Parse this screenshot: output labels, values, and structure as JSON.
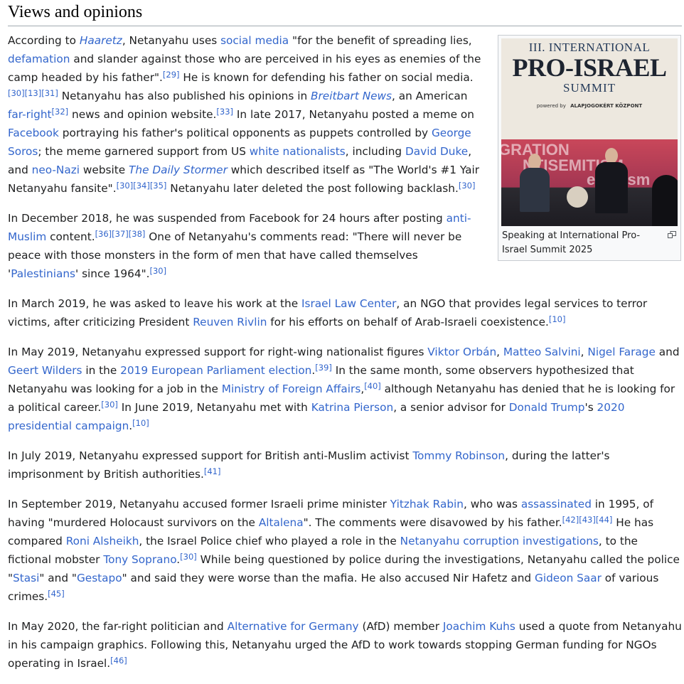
{
  "section": {
    "title": "Views and opinions"
  },
  "figure": {
    "banner_line1": "III. INTERNATIONAL",
    "banner_line2": "PRO-ISRAEL",
    "banner_line3": "SUMMIT",
    "banner_powered": "powered by",
    "banner_org": "ALAPJOGOKÉRT KÖZPONT",
    "stage_text_1": "GRATION",
    "stage_text_2": "NTISEMITISM",
    "stage_text_3": "errorism",
    "caption": "Speaking at International Pro-Israel Summit 2025",
    "enlarge_icon": "enlarge-icon"
  },
  "paragraphs": [
    {
      "name": "para-haaretz",
      "narrow": true,
      "runs": [
        {
          "t": "According to "
        },
        {
          "t": "Haaretz",
          "link": true,
          "italic": true
        },
        {
          "t": ", Netanyahu uses "
        },
        {
          "t": "social media",
          "link": true
        },
        {
          "t": " \"for the benefit of spreading lies, "
        },
        {
          "t": "defamation",
          "link": true
        },
        {
          "t": " and slander against those who are perceived in his eyes as enemies of the camp headed by his father\"."
        },
        {
          "t": "[29]",
          "sup": true
        },
        {
          "t": " He is known for defending his father on social media."
        },
        {
          "t": "[30]",
          "sup": true
        },
        {
          "t": "[13]",
          "sup": true
        },
        {
          "t": "[31]",
          "sup": true
        },
        {
          "t": " Netanyahu has also published his opinions in "
        },
        {
          "t": "Breitbart News",
          "link": true,
          "italic": true
        },
        {
          "t": ", an American "
        },
        {
          "t": "far-right",
          "link": true
        },
        {
          "t": "[32]",
          "sup": true
        },
        {
          "t": " news and opinion website."
        },
        {
          "t": "[33]",
          "sup": true
        },
        {
          "t": " In late 2017, Netanyahu posted a meme on "
        },
        {
          "t": "Facebook",
          "link": true
        },
        {
          "t": " portraying his father's political opponents as puppets controlled by "
        },
        {
          "t": "George Soros",
          "link": true
        },
        {
          "t": "; the meme garnered support from US "
        },
        {
          "t": "white nationalists",
          "link": true
        },
        {
          "t": ", including "
        },
        {
          "t": "David Duke",
          "link": true
        },
        {
          "t": ", and "
        },
        {
          "t": "neo-Nazi",
          "link": true
        },
        {
          "t": " website "
        },
        {
          "t": "The Daily Stormer",
          "link": true,
          "italic": true
        },
        {
          "t": " which described itself as \"The World's #1 Yair Netanyahu fansite\"."
        },
        {
          "t": "[30]",
          "sup": true
        },
        {
          "t": "[34]",
          "sup": true
        },
        {
          "t": "[35]",
          "sup": true
        },
        {
          "t": " Netanyahu later deleted the post following backlash."
        },
        {
          "t": "[30]",
          "sup": true
        }
      ]
    },
    {
      "name": "para-facebook-suspension",
      "narrow": true,
      "runs": [
        {
          "t": "In December 2018, he was suspended from Facebook for 24 hours after posting "
        },
        {
          "t": "anti-Muslim",
          "link": true
        },
        {
          "t": " content."
        },
        {
          "t": "[36]",
          "sup": true
        },
        {
          "t": "[37]",
          "sup": true
        },
        {
          "t": "[38]",
          "sup": true
        },
        {
          "t": " One of Netanyahu's comments read: \"There will never be peace with those monsters in the form of men that have called themselves '"
        },
        {
          "t": "Palestinians",
          "link": true
        },
        {
          "t": "' since 1964\"."
        },
        {
          "t": "[30]",
          "sup": true
        }
      ]
    },
    {
      "name": "para-law-center",
      "narrow": false,
      "runs": [
        {
          "t": "In March 2019, he was asked to leave his work at the "
        },
        {
          "t": "Israel Law Center",
          "link": true
        },
        {
          "t": ", an NGO that provides legal services to terror victims, after criticizing President "
        },
        {
          "t": "Reuven Rivlin",
          "link": true
        },
        {
          "t": " for his efforts on behalf of Arab-Israeli coexistence."
        },
        {
          "t": "[10]",
          "sup": true
        }
      ]
    },
    {
      "name": "para-nationalists",
      "narrow": false,
      "runs": [
        {
          "t": "In May 2019, Netanyahu expressed support for right-wing nationalist figures "
        },
        {
          "t": "Viktor Orbán",
          "link": true
        },
        {
          "t": ", "
        },
        {
          "t": "Matteo Salvini",
          "link": true
        },
        {
          "t": ", "
        },
        {
          "t": "Nigel Farage",
          "link": true
        },
        {
          "t": " and "
        },
        {
          "t": "Geert Wilders",
          "link": true
        },
        {
          "t": " in the "
        },
        {
          "t": "2019 European Parliament election",
          "link": true
        },
        {
          "t": "."
        },
        {
          "t": "[39]",
          "sup": true
        },
        {
          "t": " In the same month, some observers hypothesized that Netanyahu was looking for a job in the "
        },
        {
          "t": "Ministry of Foreign Affairs",
          "link": true
        },
        {
          "t": ","
        },
        {
          "t": "[40]",
          "sup": true
        },
        {
          "t": " although Netanyahu has denied that he is looking for a political career."
        },
        {
          "t": "[30]",
          "sup": true
        },
        {
          "t": " In June 2019, Netanyahu met with "
        },
        {
          "t": "Katrina Pierson",
          "link": true
        },
        {
          "t": ", a senior advisor for "
        },
        {
          "t": "Donald Trump",
          "link": true
        },
        {
          "t": "'s "
        },
        {
          "t": "2020 presidential campaign",
          "link": true
        },
        {
          "t": "."
        },
        {
          "t": "[10]",
          "sup": true
        }
      ]
    },
    {
      "name": "para-robinson",
      "narrow": false,
      "runs": [
        {
          "t": "In July 2019, Netanyahu expressed support for British anti-Muslim activist "
        },
        {
          "t": "Tommy Robinson",
          "link": true
        },
        {
          "t": ", during the latter's imprisonment by British authorities."
        },
        {
          "t": "[41]",
          "sup": true
        }
      ]
    },
    {
      "name": "para-rabin",
      "narrow": false,
      "runs": [
        {
          "t": "In September 2019, Netanyahu accused former Israeli prime minister "
        },
        {
          "t": "Yitzhak Rabin",
          "link": true
        },
        {
          "t": ", who was "
        },
        {
          "t": "assassinated",
          "link": true
        },
        {
          "t": " in 1995, of having \"murdered Holocaust survivors on the "
        },
        {
          "t": "Altalena",
          "link": true
        },
        {
          "t": "\". The comments were disavowed by his father."
        },
        {
          "t": "[42]",
          "sup": true
        },
        {
          "t": "[43]",
          "sup": true
        },
        {
          "t": "[44]",
          "sup": true
        },
        {
          "t": " He has compared "
        },
        {
          "t": "Roni Alsheikh",
          "link": true
        },
        {
          "t": ", the Israel Police chief who played a role in the "
        },
        {
          "t": "Netanyahu corruption investigations",
          "link": true
        },
        {
          "t": ", to the fictional mobster "
        },
        {
          "t": "Tony Soprano",
          "link": true
        },
        {
          "t": "."
        },
        {
          "t": "[30]",
          "sup": true
        },
        {
          "t": " While being questioned by police during the investigations, Netanyahu called the police \""
        },
        {
          "t": "Stasi",
          "link": true
        },
        {
          "t": "\" and \""
        },
        {
          "t": "Gestapo",
          "link": true
        },
        {
          "t": "\" and said they were worse than the mafia. He also accused Nir Hafetz and "
        },
        {
          "t": "Gideon Saar",
          "link": true
        },
        {
          "t": " of various crimes."
        },
        {
          "t": "[45]",
          "sup": true
        }
      ]
    },
    {
      "name": "para-afd",
      "narrow": false,
      "runs": [
        {
          "t": "In May 2020, the far-right politician and "
        },
        {
          "t": "Alternative for Germany",
          "link": true
        },
        {
          "t": " (AfD) member "
        },
        {
          "t": "Joachim Kuhs",
          "link": true
        },
        {
          "t": " used a quote from Netanyahu in his campaign graphics. Following this, Netanyahu urged the AfD to work towards stopping German funding for NGOs operating in Israel."
        },
        {
          "t": "[46]",
          "sup": true
        }
      ]
    }
  ]
}
